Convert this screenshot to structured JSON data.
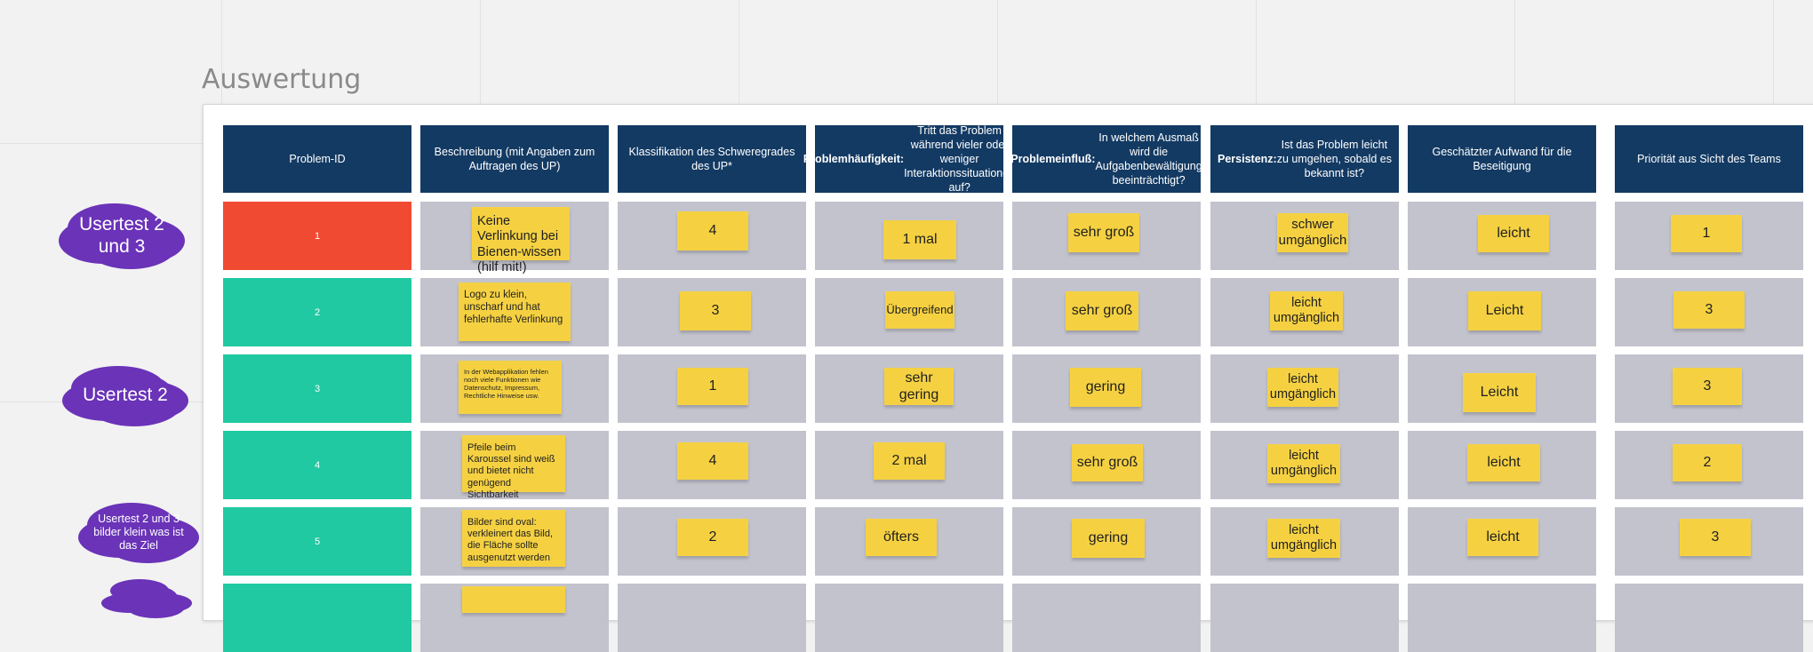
{
  "board": {
    "frame_title": "Auswertung"
  },
  "headers": [
    {
      "bold": "",
      "text": "Problem-ID"
    },
    {
      "bold": "",
      "text": "Beschreibung (mit Angaben zum Auftragen des UP)"
    },
    {
      "bold": "",
      "text": "Klassifikation des Schweregrades des UP*"
    },
    {
      "bold": "Problemhäufigkeit:",
      "text": " Tritt das Problem während vieler oder weniger Interaktionssituationen auf?"
    },
    {
      "bold": "Problemeinfluß:",
      "text": " In welchem Ausmaß wird die Aufgabenbewältigung beeinträchtigt?"
    },
    {
      "bold": "Persistenz:",
      "text": " Ist das Problem leicht zu umgehen, sobald es bekannt ist?"
    },
    {
      "bold": "",
      "text": "Geschätzter Aufwand für die Beseitigung"
    },
    {
      "bold": "",
      "text": "Priorität aus Sicht des Teams"
    }
  ],
  "rows": [
    {
      "id": "1",
      "color": "#f04b32",
      "desc": "Keine Verlinkung bei Bienen-wissen (hilf mit!)",
      "severity": "4",
      "frequency": "1 mal",
      "impact": "sehr groß",
      "persistence": "schwer umgänglich",
      "effort": "leicht",
      "priority": "1"
    },
    {
      "id": "2",
      "color": "#20c9a2",
      "desc": "Logo zu klein, unscharf und hat fehlerhafte Verlinkung",
      "severity": "3",
      "frequency": "Übergreifend",
      "impact": "sehr groß",
      "persistence": "leicht umgänglich",
      "effort": "Leicht",
      "priority": "3"
    },
    {
      "id": "3",
      "color": "#20c9a2",
      "desc": "In der Webapplikation fehlen noch viele Funktionen wie Datenschutz, Impressum, Rechtliche Hinweise usw.",
      "severity": "1",
      "frequency": "sehr gering",
      "impact": "gering",
      "persistence": "leicht umgänglich",
      "effort": "Leicht",
      "priority": "3"
    },
    {
      "id": "4",
      "color": "#20c9a2",
      "desc": "Pfeile beim Karoussel sind weiß und bietet nicht genügend Sichtbarkeit",
      "severity": "4",
      "frequency": "2 mal",
      "impact": "sehr groß",
      "persistence": "leicht umgänglich",
      "effort": "leicht",
      "priority": "2"
    },
    {
      "id": "5",
      "color": "#20c9a2",
      "desc": "Bilder sind oval: verkleinert das Bild, die Fläche sollte ausgenutzt werden",
      "severity": "2",
      "frequency": "öfters",
      "impact": "gering",
      "persistence": "leicht umgänglich",
      "effort": "leicht",
      "priority": "3"
    }
  ],
  "clouds": [
    {
      "label": "Usertest 2 und 3"
    },
    {
      "label": "Usertest 2"
    },
    {
      "label": "Usertest 2 und 3 bilder klein was ist das Ziel"
    }
  ],
  "colors": {
    "header_bg": "#133a63",
    "cell_bg": "#c3c3ce",
    "sticky_note": "#f5d142",
    "cloud": "#6a33b8",
    "red": "#f04b32",
    "teal": "#20c9a2"
  }
}
